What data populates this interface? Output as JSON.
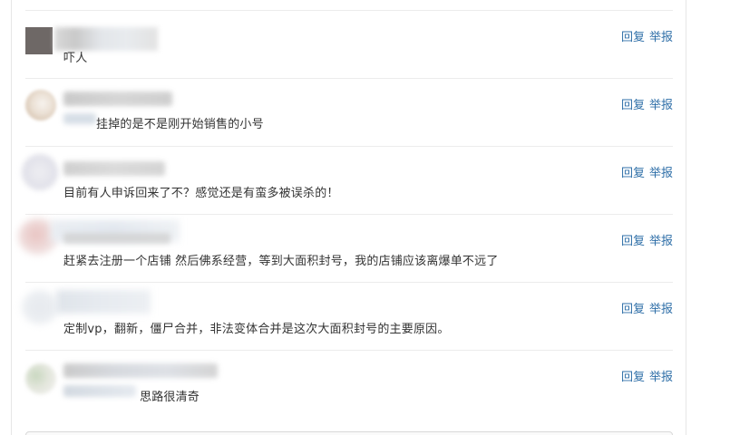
{
  "comments": [
    {
      "text": "吓人",
      "actions": {
        "reply": "回复",
        "report": "举报"
      }
    },
    {
      "text": "挂掉的是不是刚开始销售的小号",
      "actions": {
        "reply": "回复",
        "report": "举报"
      }
    },
    {
      "text": "目前有人申诉回来了不？感觉还是有蛮多被误杀的！",
      "actions": {
        "reply": "回复",
        "report": "举报"
      }
    },
    {
      "text": "赶紧去注册一个店铺 然后佛系经营，等到大面积封号，我的店铺应该离爆单不远了",
      "actions": {
        "reply": "回复",
        "report": "举报"
      }
    },
    {
      "text": "定制vp，翻新，僵尸合并，非法变体合并是这次大面积封号的主要原因。",
      "actions": {
        "reply": "回复",
        "report": "举报"
      }
    },
    {
      "text": "思路很清奇",
      "actions": {
        "reply": "回复",
        "report": "举报"
      }
    }
  ]
}
